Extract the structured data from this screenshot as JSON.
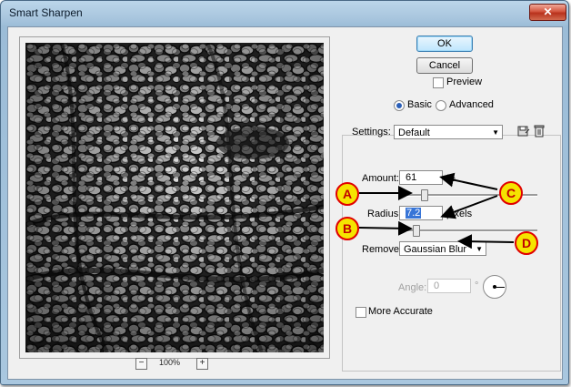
{
  "window": {
    "title": "Smart Sharpen",
    "close_glyph": "✕"
  },
  "buttons": {
    "ok": "OK",
    "cancel": "Cancel"
  },
  "preview_toggle": {
    "label": "Preview",
    "checked": false
  },
  "mode": {
    "basic": "Basic",
    "advanced": "Advanced",
    "selected": "Basic"
  },
  "settings": {
    "label": "Settings:",
    "value": "Default",
    "save_icon": "save-settings-icon",
    "delete_icon": "trash-icon"
  },
  "amount": {
    "label": "Amount:",
    "value": "61",
    "unit": "%",
    "slider_value": 0.18
  },
  "radius": {
    "label": "Radius:",
    "value": "7.2",
    "unit": "pixels",
    "slider_value": 0.12
  },
  "remove": {
    "label": "Remove:",
    "value": "Gaussian Blur"
  },
  "angle": {
    "label": "Angle:",
    "value": "0",
    "unit": "°"
  },
  "more_accurate": {
    "label": "More Accurate",
    "checked": false
  },
  "zoom": {
    "minus": "−",
    "plus": "+",
    "level": "100%"
  },
  "annotations": {
    "a": "A",
    "b": "B",
    "c": "C",
    "d": "D"
  },
  "colors": {
    "callout_fill": "#f5e400",
    "callout_border": "#e00000",
    "selection": "#3875d7"
  }
}
